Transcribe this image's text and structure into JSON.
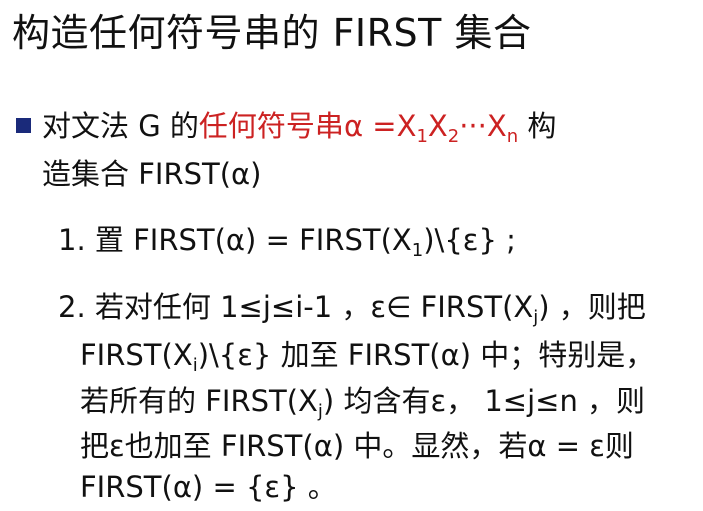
{
  "title": "构造任何符号串的 FIRST 集合",
  "bullet": {
    "pre": "对文法 G 的",
    "red_text": "任何符号串",
    "alpha_eq": "α =X",
    "s1": "1",
    "x2": "X",
    "s2": "2",
    "dots": "···X",
    "sn": "n",
    "post": " 构",
    "line2": "造集合 FIRST(α)"
  },
  "step1": {
    "pre": "1.  置 FIRST(α)  =  FIRST(X",
    "sub": "1",
    "post": ")\\{ε} ;"
  },
  "step2": {
    "l1_pre": "2.  若对任何 1≤j≤i-1 ，ε∈ FIRST(X",
    "l1_sub": "j",
    "l1_post": ") ，则把",
    "l2_pre": "FIRST(X",
    "l2_sub": "i",
    "l2_post": ")\\{ε} 加至 FIRST(α) 中；特别是，",
    "l3_pre": "若所有的 FIRST(X",
    "l3_sub": "j",
    "l3_post": ") 均含有ε，  1≤j≤n ，则",
    "l4": "把ε也加至 FIRST(α) 中。显然，若α = ε则",
    "l5": "FIRST(α)  =  {ε} 。"
  }
}
